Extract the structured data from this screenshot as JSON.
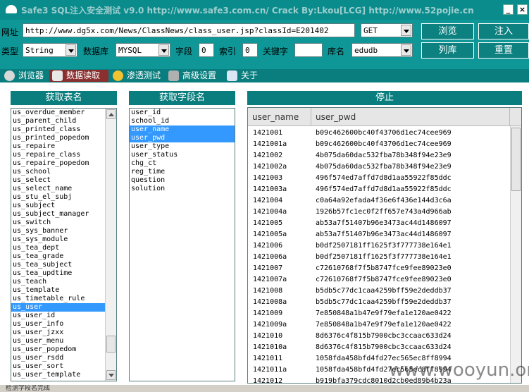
{
  "title": "Safe3 SQL注入安全测试 v9.0 http://www.safe3.com.cn/     Crack By:Lkou[LCG]     http://www.52pojie.cn",
  "toolbar": {
    "url_label": "网址",
    "url_value": "http://www.dg5x.com/News/ClassNews/class_user.jsp?classId=E201402",
    "method_value": "GET",
    "browse_button": "浏览",
    "inject_button": "注入",
    "type_label": "类型",
    "type_value": "String",
    "db_label": "数据库",
    "db_value": "MYSQL",
    "field_label": "字段",
    "field_value": "0",
    "index_label": "索引",
    "index_value": "0",
    "keyword_label": "关键字",
    "keyword_value": "",
    "dbname_label": "库名",
    "dbname_value": "edudb",
    "list_db_button": "列库",
    "reset_button": "重置"
  },
  "tabs": [
    {
      "label": "浏览器"
    },
    {
      "label": "数据读取"
    },
    {
      "label": "渗透测试"
    },
    {
      "label": "高级设置"
    },
    {
      "label": "关于"
    }
  ],
  "tables_panel": {
    "header": "获取表名",
    "items": [
      "us_overdue_member",
      "us_parent_child",
      "us_printed_class",
      "us_printed_popedom",
      "us_repaire",
      "us_repaire_class",
      "us_repaire_popedom",
      "us_school",
      "us_select",
      "us_select_name",
      "us_stu_el_subj",
      "us_subject",
      "us_subject_manager",
      "us_switch",
      "us_sys_banner",
      "us_sys_module",
      "us_tea_dept",
      "us_tea_grade",
      "us_tea_subject",
      "us_tea_updtime",
      "us_teach",
      "us_template",
      "us_timetable_rule",
      "us_user",
      "us_user_id",
      "us_user_info",
      "us_user_jzxx",
      "us_user_menu",
      "us_user_popedom",
      "us_user_rsdd",
      "us_user_sort",
      "us_user_template"
    ],
    "selected": "us_user"
  },
  "fields_panel": {
    "header": "获取字段名",
    "items": [
      "user_id",
      "school_id",
      "user_name",
      "user_pwd",
      "user_type",
      "user_status",
      "chg_ct",
      "reg_time",
      "question",
      "solution"
    ],
    "selected": [
      "user_name",
      "user_pwd"
    ]
  },
  "data_panel": {
    "header": "停止",
    "columns": [
      "user_name",
      "user_pwd"
    ],
    "rows": [
      [
        "1421001",
        "b09c462600bc40f43706d1ec74cee969"
      ],
      [
        "1421001a",
        "b09c462600bc40f43706d1ec74cee969"
      ],
      [
        "1421002",
        "4b075da60dac532fba78b348f94e23e9"
      ],
      [
        "1421002a",
        "4b075da60dac532fba78b348f94e23e9"
      ],
      [
        "1421003",
        "496f574ed7affd7d8d1aa55922f85ddc"
      ],
      [
        "1421003a",
        "496f574ed7affd7d8d1aa55922f85ddc"
      ],
      [
        "1421004",
        "c0a64a92efada4f36e6f436e144d3c6a"
      ],
      [
        "1421004a",
        "1926b57fc1ec0f2ff657e743a4d966ab"
      ],
      [
        "1421005",
        "ab53a7f51407b96e3473ac44d1486097"
      ],
      [
        "1421005a",
        "ab53a7f51407b96e3473ac44d1486097"
      ],
      [
        "1421006",
        "b0df2507181ff1625f3f777738e164e1"
      ],
      [
        "1421006a",
        "b0df2507181ff1625f3f777738e164e1"
      ],
      [
        "1421007",
        "c72610768f7f5b8747fce9fee89023e0"
      ],
      [
        "1421007a",
        "c72610768f7f5b8747fce9fee89023e0"
      ],
      [
        "1421008",
        "b5db5c77dc1caa4259bff59e2deddb37"
      ],
      [
        "1421008a",
        "b5db5c77dc1caa4259bff59e2deddb37"
      ],
      [
        "1421009",
        "7e850848a1b47e9f79efa1e120ae0422"
      ],
      [
        "1421009a",
        "7e850848a1b47e9f79efa1e120ae0422"
      ],
      [
        "1421010",
        "8d6376c4f815b7900cbc3ccaac633d24"
      ],
      [
        "1421010a",
        "8d6376c4f815b7900cbc3ccaac633d24"
      ],
      [
        "1421011",
        "1058fda458bfd4fd27ec565ec8ff8994"
      ],
      [
        "1421011a",
        "1058fda458bfd4fd27ec565ec8ff8994"
      ],
      [
        "1421012",
        "b919bfa379cdc8010d2cb0ed89b4b23a"
      ]
    ]
  },
  "status_text": "检测字段名完成",
  "watermark": "www.wooyun.org",
  "colors": {
    "accent": "#0f9696",
    "tab_active": "#8b2f2f",
    "selection": "#3399ff"
  }
}
